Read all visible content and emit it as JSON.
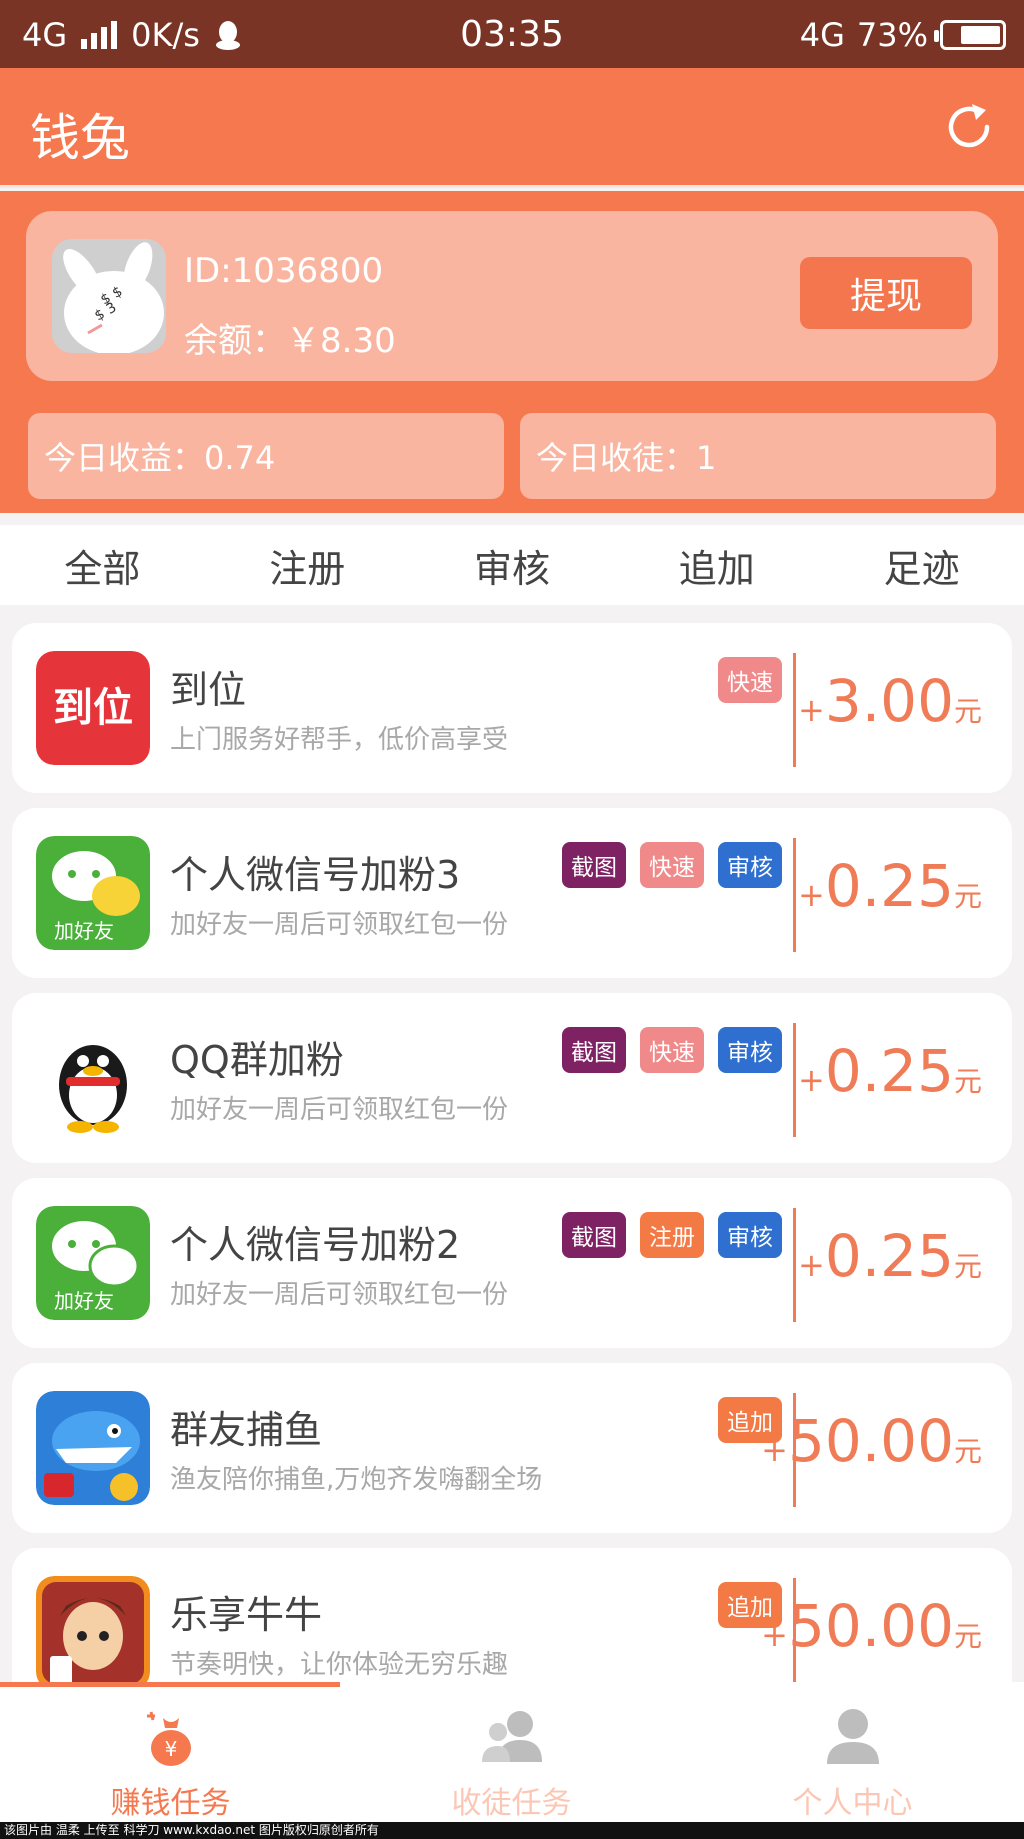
{
  "status_bar": {
    "network": "4G",
    "speed": "0K/s",
    "time": "03:35",
    "network_right": "4G",
    "battery": "73%",
    "battery_level": 0.73
  },
  "app_bar": {
    "title": "钱兔"
  },
  "account": {
    "id": "ID:1036800",
    "balance": "余额：￥8.30",
    "withdraw_label": "提现"
  },
  "stats": {
    "today_income": "今日收益：0.74",
    "today_apprentice": "今日收徒：1"
  },
  "tabs": [
    {
      "label": "全部"
    },
    {
      "label": "注册"
    },
    {
      "label": "审核"
    },
    {
      "label": "追加"
    },
    {
      "label": "足迹"
    }
  ],
  "tasks": [
    {
      "title": "到位",
      "desc": "上门服务好帮手，低价高享受",
      "tags": [
        {
          "label": "快速",
          "color": "#f08a8a"
        }
      ],
      "plus": "+",
      "amount": "3.00",
      "unit": "元",
      "icon": "daowei-icon"
    },
    {
      "title": "个人微信号加粉3",
      "desc": "加好友一周后可领取红包一份",
      "tags": [
        {
          "label": "截图",
          "color": "#7f2264"
        },
        {
          "label": "快速",
          "color": "#f08a8a"
        },
        {
          "label": "审核",
          "color": "#2f6fcf"
        }
      ],
      "plus": "+",
      "amount": "0.25",
      "unit": "元",
      "icon": "wechat-add-friend-icon",
      "icon_text": "加好友"
    },
    {
      "title": "QQ群加粉",
      "desc": "加好友一周后可领取红包一份",
      "tags": [
        {
          "label": "截图",
          "color": "#7f2264"
        },
        {
          "label": "快速",
          "color": "#f08a8a"
        },
        {
          "label": "审核",
          "color": "#2f6fcf"
        }
      ],
      "plus": "+",
      "amount": "0.25",
      "unit": "元",
      "icon": "qq-penguin-icon"
    },
    {
      "title": "个人微信号加粉2",
      "desc": "加好友一周后可领取红包一份",
      "tags": [
        {
          "label": "截图",
          "color": "#7f2264"
        },
        {
          "label": "注册",
          "color": "#f47a45"
        },
        {
          "label": "审核",
          "color": "#2f6fcf"
        }
      ],
      "plus": "+",
      "amount": "0.25",
      "unit": "元",
      "icon": "wechat-add-friend-icon",
      "icon_text": "加好友"
    },
    {
      "title": "群友捕鱼",
      "desc": "渔友陪你捕鱼,万炮齐发嗨翻全场",
      "tags": [
        {
          "label": "追加",
          "color": "#f47a45"
        }
      ],
      "plus": "+",
      "amount": "50.00",
      "unit": "元",
      "icon": "fishing-game-icon"
    },
    {
      "title": "乐享牛牛",
      "desc": "节奏明快，让你体验无穷乐趣",
      "tags": [
        {
          "label": "追加",
          "color": "#f47a45"
        }
      ],
      "plus": "+",
      "amount": "50.00",
      "unit": "元",
      "icon": "card-game-icon"
    }
  ],
  "bottom_nav": [
    {
      "label": "赚钱任务",
      "active": true,
      "icon": "money-bag-icon"
    },
    {
      "label": "收徒任务",
      "active": false,
      "icon": "group-users-icon"
    },
    {
      "label": "个人中心",
      "active": false,
      "icon": "user-icon"
    }
  ],
  "colors": {
    "primary": "#f5784f",
    "status_bar": "#7a3426",
    "reward": "#ef7c57",
    "nav_inactive": "#fbc7b4"
  },
  "watermark": "该图片由 温柔 上传至 科学刀 www.kxdao.net 图片版权归原创者所有"
}
